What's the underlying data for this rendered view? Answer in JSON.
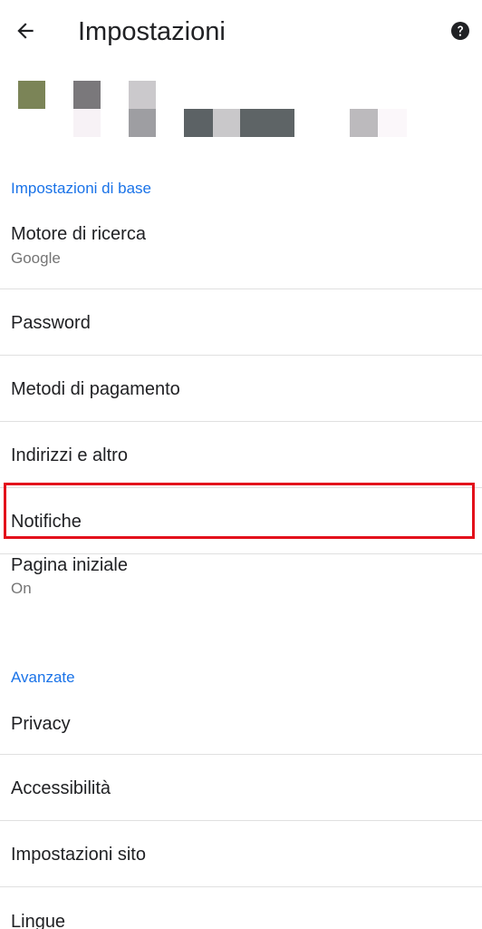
{
  "appbar": {
    "title": "Impostazioni",
    "back_icon": "arrow-back-icon",
    "help_icon": "help-circle-icon"
  },
  "sections": {
    "basic": "Impostazioni di base",
    "advanced": "Avanzate"
  },
  "items": {
    "search_engine": {
      "label": "Motore di ricerca",
      "value": "Google"
    },
    "password": {
      "label": "Password"
    },
    "payment": {
      "label": "Metodi di pagamento"
    },
    "addresses": {
      "label": "Indirizzi e altro"
    },
    "notifications": {
      "label": "Notifiche"
    },
    "homepage": {
      "label": "Pagina iniziale",
      "value": "On"
    },
    "privacy": {
      "label": "Privacy"
    },
    "accessibility": {
      "label": "Accessibilità"
    },
    "site_settings": {
      "label": "Impostazioni sito"
    },
    "languages": {
      "label": "Lingue"
    }
  },
  "colors": {
    "accent": "#1a73e8",
    "highlight": "#e3111b",
    "divider": "#e0e0e0"
  }
}
